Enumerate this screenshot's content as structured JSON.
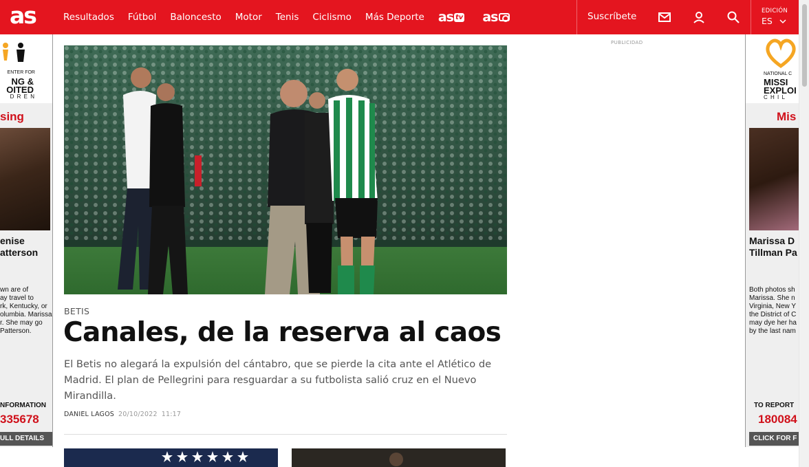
{
  "header": {
    "logo": "as",
    "nav": [
      "Resultados",
      "Fútbol",
      "Baloncesto",
      "Motor",
      "Tenis",
      "Ciclismo",
      "Más Deporte"
    ],
    "brand_tv": "as",
    "brand_tv_suffix": "tv",
    "brand_foto": "as",
    "subscribe": "Suscríbete",
    "edition_label": "EDICIÓN",
    "edition_value": "ES",
    "icons": [
      "mail-icon",
      "user-icon",
      "search-icon",
      "chevron-down-icon"
    ],
    "bg_color": "#e4151f"
  },
  "publicidad": "PUBLICIDAD",
  "ad_left": {
    "org_line1": "ENTER FOR",
    "org_line2": "NG &",
    "org_line3": "OITED",
    "org_line4": "D R E N",
    "missing": "sing",
    "name_line1": "enise",
    "name_line2": "atterson",
    "desc": [
      "wn are of",
      "ay travel to",
      "rk, Kentucky, or",
      "olumbia. Marissa",
      "r. She may go",
      "Patterson."
    ],
    "info": "NFORMATION",
    "phone": "335678",
    "details": "ULL DETAILS"
  },
  "ad_right": {
    "org_line1": "NATIONAL C",
    "org_line2": "MISSI",
    "org_line3": "EXPLOI",
    "org_line4": "C H I L",
    "missing": "Mis",
    "name_line1": "Marissa D",
    "name_line2": "Tillman Pa",
    "desc": [
      "Both photos sh",
      "Marissa.  She n",
      "Virginia, New Y",
      "the District of C",
      "may dye her ha",
      "by the last nam"
    ],
    "report": "TO REPORT",
    "phone": "180084",
    "click": "CLICK FOR F"
  },
  "article": {
    "kicker": "BETIS",
    "headline": "Canales, de la reserva al caos",
    "summary": "El Betis no alegará la expulsión del cántabro, que se pierde la cita ante el Atlético de Madrid. El plan de Pellegrini para resguardar a su futbolista salió cruz en el Nuevo Mirandilla.",
    "author": "DANIEL LAGOS",
    "date": "20/10/2022",
    "time": "11:17"
  }
}
